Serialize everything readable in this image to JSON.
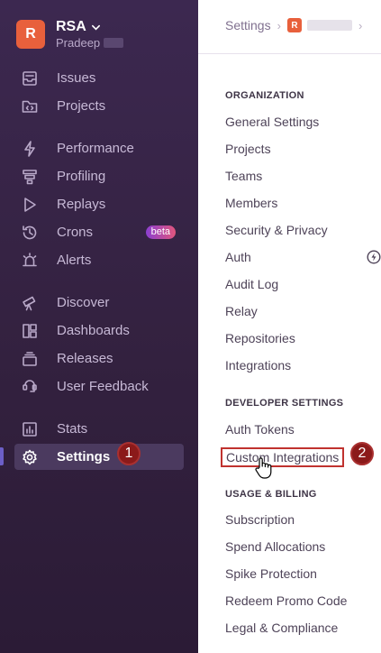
{
  "org": {
    "initial": "R",
    "name": "RSA",
    "user": "Pradeep"
  },
  "nav": {
    "issues": "Issues",
    "projects": "Projects",
    "performance": "Performance",
    "profiling": "Profiling",
    "replays": "Replays",
    "crons": "Crons",
    "crons_badge": "beta",
    "alerts": "Alerts",
    "discover": "Discover",
    "dashboards": "Dashboards",
    "releases": "Releases",
    "user_feedback": "User Feedback",
    "stats": "Stats",
    "settings": "Settings"
  },
  "steps": {
    "one": "1",
    "two": "2"
  },
  "breadcrumb": {
    "root": "Settings",
    "org_initial": "R"
  },
  "settings_menu": {
    "organization": {
      "title": "ORGANIZATION",
      "items": [
        "General Settings",
        "Projects",
        "Teams",
        "Members",
        "Security & Privacy",
        "Auth",
        "Audit Log",
        "Relay",
        "Repositories",
        "Integrations"
      ]
    },
    "developer": {
      "title": "DEVELOPER SETTINGS",
      "items": [
        "Auth Tokens",
        "Custom Integrations"
      ]
    },
    "billing": {
      "title": "USAGE & BILLING",
      "items": [
        "Subscription",
        "Spend Allocations",
        "Spike Protection",
        "Redeem Promo Code",
        "Legal & Compliance"
      ]
    }
  },
  "colors": {
    "sidebar_bg": "#3c2850",
    "accent": "#6c5fc7",
    "org_avatar": "#e8603c",
    "step_badge": "#8b1a1a",
    "highlight_border": "#c0322f"
  },
  "icons": {
    "issues": "inbox-icon",
    "projects": "folder-code-icon",
    "performance": "lightning-icon",
    "profiling": "funnel-icon",
    "replays": "play-icon",
    "crons": "clock-history-icon",
    "alerts": "siren-icon",
    "discover": "telescope-icon",
    "dashboards": "dashboard-icon",
    "releases": "stack-icon",
    "user_feedback": "megaphone-icon",
    "stats": "bar-chart-icon",
    "settings": "gear-icon"
  }
}
